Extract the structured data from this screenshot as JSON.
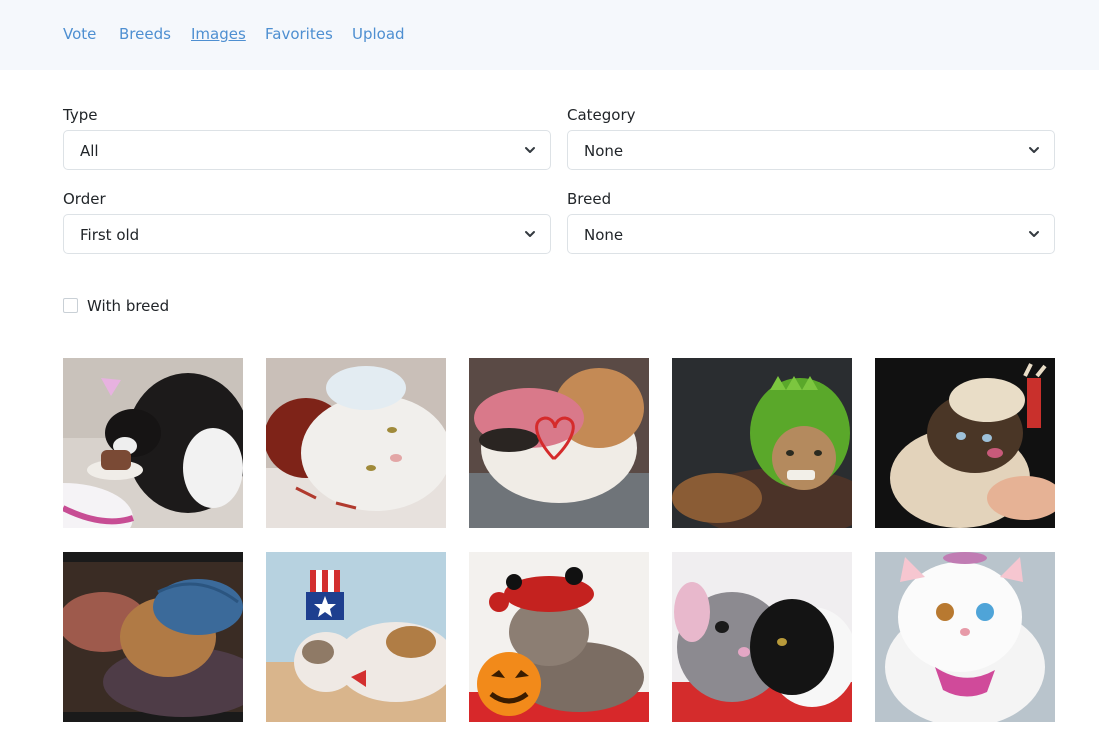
{
  "nav": {
    "items": [
      {
        "label": "Vote",
        "active": false
      },
      {
        "label": "Breeds",
        "active": false
      },
      {
        "label": "Images",
        "active": true
      },
      {
        "label": "Favorites",
        "active": false
      },
      {
        "label": "Upload",
        "active": false
      }
    ]
  },
  "filters": {
    "type": {
      "label": "Type",
      "value": "All"
    },
    "category": {
      "label": "Category",
      "value": "None"
    },
    "order": {
      "label": "Order",
      "value": "First old"
    },
    "breed": {
      "label": "Breed",
      "value": "None"
    },
    "with_breed": {
      "label": "With breed",
      "checked": false
    }
  },
  "gallery": {
    "images": [
      {
        "subject": "black-and-white cat with small party hat sniffing a cake"
      },
      {
        "subject": "white cat lying on red knitted blanket"
      },
      {
        "subject": "calico cat wearing pink crochet hat"
      },
      {
        "subject": "tabby cat wearing green dinosaur hat"
      },
      {
        "subject": "siamese kitten wearing knitted hat with antlers"
      },
      {
        "subject": "ginger cat wearing blue knitted hat"
      },
      {
        "subject": "kitten wearing stars and stripes top hat"
      },
      {
        "subject": "tabby cat with red devil hat and jack-o-lantern"
      },
      {
        "subject": "black and white cat in grey mouse costume"
      },
      {
        "subject": "white cat with heterochromia wearing bunny ear hood"
      }
    ]
  },
  "colors": {
    "nav_bg": "#f5f8fc",
    "link": "#4e8fd1",
    "border": "#dde2e6"
  }
}
